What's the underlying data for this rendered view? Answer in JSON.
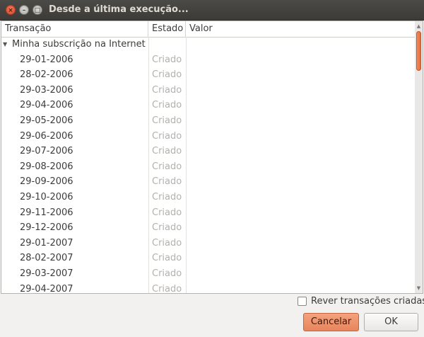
{
  "window": {
    "title": "Desde a última execução...",
    "close_glyph": "×",
    "min_glyph": "–",
    "max_glyph": "□"
  },
  "columns": {
    "transacao": "Transação",
    "estado": "Estado",
    "valor": "Valor"
  },
  "tree": {
    "parent_label": "Minha subscrição na Internet",
    "expander_glyph": "▼",
    "rows": [
      {
        "date": "29-01-2006",
        "status": "Criado",
        "value": ""
      },
      {
        "date": "28-02-2006",
        "status": "Criado",
        "value": ""
      },
      {
        "date": "29-03-2006",
        "status": "Criado",
        "value": ""
      },
      {
        "date": "29-04-2006",
        "status": "Criado",
        "value": ""
      },
      {
        "date": "29-05-2006",
        "status": "Criado",
        "value": ""
      },
      {
        "date": "29-06-2006",
        "status": "Criado",
        "value": ""
      },
      {
        "date": "29-07-2006",
        "status": "Criado",
        "value": ""
      },
      {
        "date": "29-08-2006",
        "status": "Criado",
        "value": ""
      },
      {
        "date": "29-09-2006",
        "status": "Criado",
        "value": ""
      },
      {
        "date": "29-10-2006",
        "status": "Criado",
        "value": ""
      },
      {
        "date": "29-11-2006",
        "status": "Criado",
        "value": ""
      },
      {
        "date": "29-12-2006",
        "status": "Criado",
        "value": ""
      },
      {
        "date": "29-01-2007",
        "status": "Criado",
        "value": ""
      },
      {
        "date": "28-02-2007",
        "status": "Criado",
        "value": ""
      },
      {
        "date": "29-03-2007",
        "status": "Criado",
        "value": ""
      },
      {
        "date": "29-04-2007",
        "status": "Criado",
        "value": ""
      }
    ]
  },
  "scrollbar": {
    "up_glyph": "▲",
    "down_glyph": "▼"
  },
  "review_checkbox": {
    "label": "Rever transações criadas",
    "checked": false
  },
  "buttons": {
    "cancel": "Cancelar",
    "ok": "OK"
  },
  "colors": {
    "accent": "#e9784b",
    "titlebar": "#3c3b37",
    "status_text": "#b3b1ad"
  },
  "icons": {
    "close": "close-icon",
    "minimize": "minimize-icon",
    "maximize": "maximize-icon",
    "expander": "expander-arrow-icon"
  }
}
